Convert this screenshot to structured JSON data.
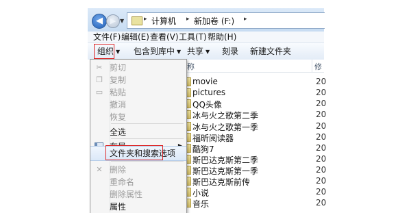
{
  "address_bar": {
    "back_glyph": "◀",
    "forward_glyph": "▶",
    "dropdown_glyph": "▼",
    "path": [
      "计算机",
      "新加卷 (F:)"
    ],
    "separator": "▸"
  },
  "menubar": {
    "items": [
      "文件(F)",
      "编辑(E)",
      "查看(V)",
      "工具(T)",
      "帮助(H)"
    ]
  },
  "toolbar": {
    "organize": "组织",
    "include_in_library": "包含到库中",
    "share": "共享",
    "burn": "刻录",
    "new_folder": "新建文件夹",
    "arrow": "▼"
  },
  "file_list": {
    "columns": {
      "name_fragment": "称",
      "modified_fragment": "修"
    },
    "rows": [
      {
        "name": "movie",
        "date": "20"
      },
      {
        "name": "pictures",
        "date": "20"
      },
      {
        "name": "QQ头像",
        "date": "20"
      },
      {
        "name": "冰与火之歌第二季",
        "date": "20"
      },
      {
        "name": "冰与火之歌第一季",
        "date": "20"
      },
      {
        "name": "福昕阅读器",
        "date": "20"
      },
      {
        "name": "酷狗7",
        "date": "20"
      },
      {
        "name": "斯巴达克斯第二季",
        "date": "20"
      },
      {
        "name": "斯巴达克斯第一季",
        "date": "20"
      },
      {
        "name": "斯巴达克斯前传",
        "date": "20"
      },
      {
        "name": "小说",
        "date": "20"
      },
      {
        "name": "音乐",
        "date": "20"
      }
    ]
  },
  "organize_menu": {
    "items": [
      {
        "label": "剪切",
        "enabled": false,
        "icon": "scissors-icon"
      },
      {
        "label": "复制",
        "enabled": false,
        "icon": "copy-icon"
      },
      {
        "label": "粘贴",
        "enabled": false,
        "icon": "paste-icon"
      },
      {
        "label": "撤消",
        "enabled": false
      },
      {
        "label": "恢复",
        "enabled": false
      },
      {
        "label": "全选",
        "enabled": true
      },
      {
        "label": "布局",
        "enabled": true,
        "icon": "layout-icon",
        "submenu": true
      },
      {
        "label": "文件夹和搜索选项",
        "enabled": true,
        "highlighted": true
      },
      {
        "label": "删除",
        "enabled": false,
        "icon": "delete-icon"
      },
      {
        "label": "重命名",
        "enabled": false
      },
      {
        "label": "删除属性",
        "enabled": false
      },
      {
        "label": "属性",
        "enabled": true,
        "icon": "properties-icon"
      }
    ],
    "submenu_glyph": "▶",
    "icon_glyphs": {
      "scissors": "✂",
      "copy": "❐",
      "paste": "▭",
      "delete": "✕"
    }
  },
  "colors": {
    "highlight_outline": "#dd2222",
    "toolbar_top": "#f8fbfe",
    "toolbar_bottom": "#e3ecf7",
    "address_chrome": "#c7dcf2"
  }
}
